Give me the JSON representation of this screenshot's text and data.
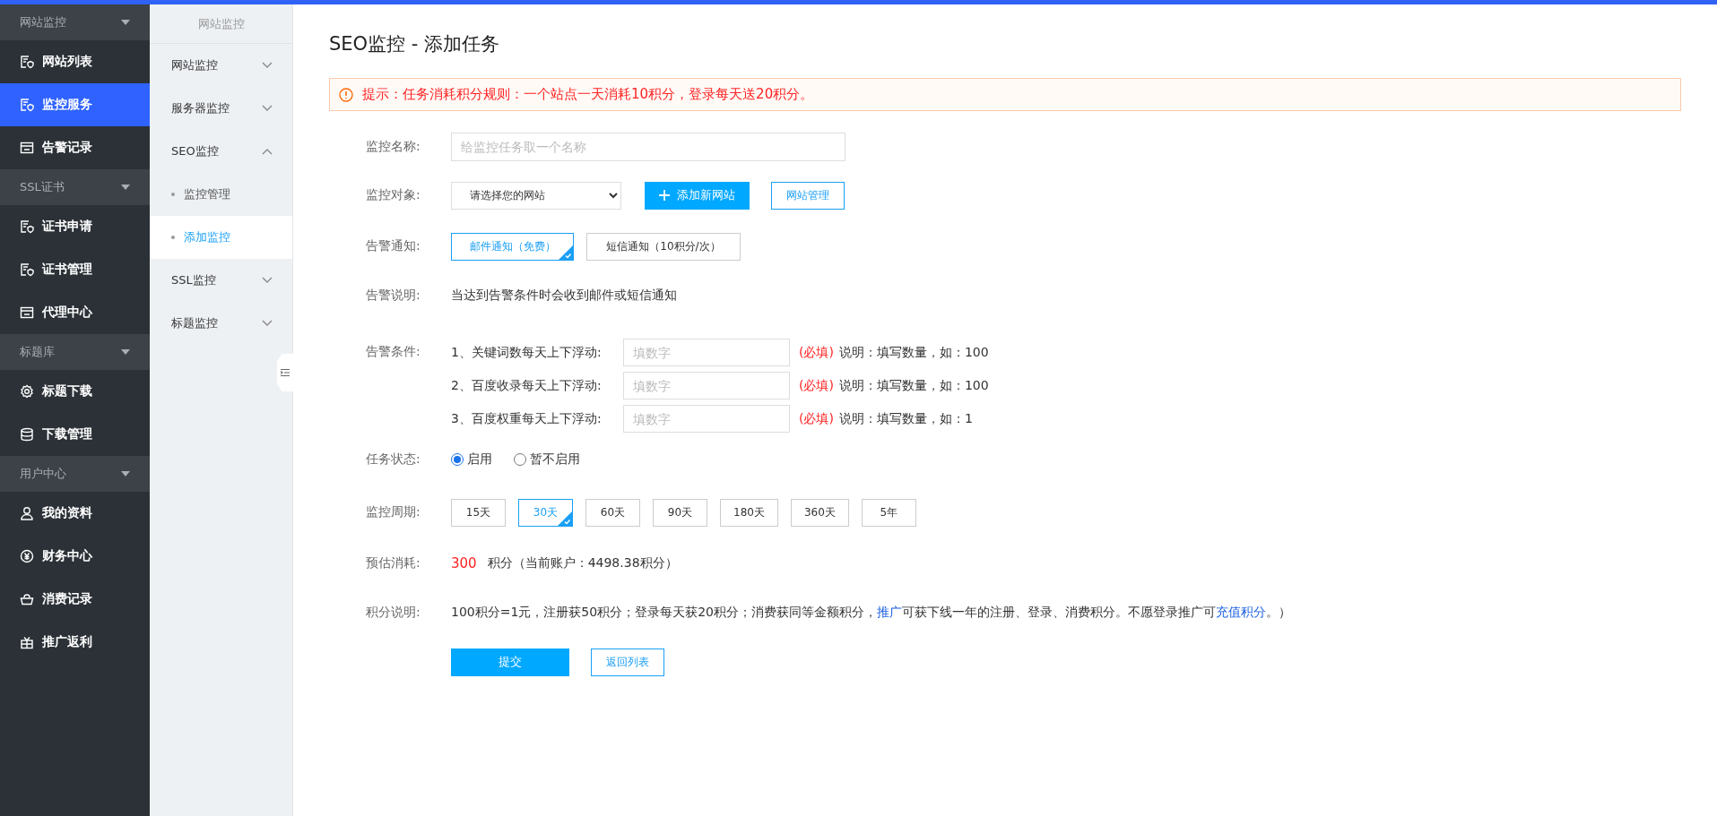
{
  "sidebar": {
    "groups": [
      {
        "title": "网站监控",
        "expanded": true,
        "items": [
          {
            "label": "网站列表",
            "kind": "doc",
            "selected": false
          },
          {
            "label": "监控服务",
            "kind": "doc",
            "selected": true
          },
          {
            "label": "告警记录",
            "kind": "panel",
            "selected": false
          }
        ]
      },
      {
        "title": "SSL证书",
        "expanded": true,
        "items": [
          {
            "label": "证书申请",
            "kind": "doc",
            "selected": false
          },
          {
            "label": "证书管理",
            "kind": "doc",
            "selected": false
          },
          {
            "label": "代理中心",
            "kind": "panel",
            "selected": false
          }
        ]
      },
      {
        "title": "标题库",
        "expanded": true,
        "items": [
          {
            "label": "标题下载",
            "kind": "gear",
            "selected": false
          },
          {
            "label": "下载管理",
            "kind": "database",
            "selected": false
          }
        ]
      },
      {
        "title": "用户中心",
        "expanded": true,
        "items": [
          {
            "label": "我的资料",
            "kind": "user",
            "selected": false
          },
          {
            "label": "财务中心",
            "kind": "yen",
            "selected": false
          },
          {
            "label": "消费记录",
            "kind": "basket",
            "selected": false
          },
          {
            "label": "推广返利",
            "kind": "gift",
            "selected": false
          }
        ]
      }
    ]
  },
  "submenu": {
    "title": "网站监控",
    "items": [
      {
        "label": "网站监控",
        "expanded": false
      },
      {
        "label": "服务器监控",
        "expanded": false
      },
      {
        "label": "SEO监控",
        "expanded": true,
        "children": [
          {
            "label": "监控管理",
            "selected": false
          },
          {
            "label": "添加监控",
            "selected": true
          }
        ]
      },
      {
        "label": "SSL监控",
        "expanded": false
      },
      {
        "label": "标题监控",
        "expanded": false
      }
    ]
  },
  "page": {
    "title": "SEO监控 - 添加任务",
    "notice": "提示：任务消耗积分规则：一个站点一天消耗10积分，登录每天送20积分。"
  },
  "form": {
    "name": {
      "label": "监控名称:",
      "placeholder": "给监控任务取一个名称"
    },
    "target": {
      "label": "监控对象:",
      "value": "请选择您的网站",
      "add_button": "添加新网站",
      "manage_button": "网站管理"
    },
    "notify": {
      "label": "告警通知:",
      "options": [
        {
          "label": "邮件通知（免费）",
          "selected": true
        },
        {
          "label": "短信通知（10积分/次）",
          "selected": false
        }
      ]
    },
    "description": {
      "label": "告警说明:",
      "text": "当达到告警条件时会收到邮件或短信通知"
    },
    "conditions": {
      "label": "告警条件:",
      "rows": [
        {
          "label": "1、关键词数每天上下浮动:",
          "placeholder": "填数字",
          "required": "(必填)",
          "note": "说明：填写数量，如：100"
        },
        {
          "label": "2、百度收录每天上下浮动:",
          "placeholder": "填数字",
          "required": "(必填)",
          "note": "说明：填写数量，如：100"
        },
        {
          "label": "3、百度权重每天上下浮动:",
          "placeholder": "填数字",
          "required": "(必填)",
          "note": "说明：填写数量，如：1"
        }
      ]
    },
    "status": {
      "label": "任务状态:",
      "options": [
        {
          "label": "启用",
          "selected": true
        },
        {
          "label": "暂不启用",
          "selected": false
        }
      ]
    },
    "period": {
      "label": "监控周期:",
      "options": [
        {
          "label": "15天",
          "selected": false
        },
        {
          "label": "30天",
          "selected": true
        },
        {
          "label": "60天",
          "selected": false
        },
        {
          "label": "90天",
          "selected": false
        },
        {
          "label": "180天",
          "selected": false
        },
        {
          "label": "360天",
          "selected": false
        },
        {
          "label": "5年",
          "selected": false
        }
      ]
    },
    "cost": {
      "label": "预估消耗:",
      "amount": "300",
      "text": "积分（当前账户：4498.38积分）"
    },
    "points": {
      "label": "积分说明:",
      "parts": [
        {
          "kind": "text",
          "text": "100积分=1元，注册获50积分；登录每天获20积分；消费获同等金额积分，"
        },
        {
          "kind": "link",
          "text": "推广"
        },
        {
          "kind": "text",
          "text": "可获下线一年的注册、登录、消费积分。不愿登录推广可"
        },
        {
          "kind": "link",
          "text": "充值积分"
        },
        {
          "kind": "text",
          "text": "。）"
        }
      ]
    },
    "actions": {
      "submit": "提交",
      "back": "返回列表"
    }
  }
}
